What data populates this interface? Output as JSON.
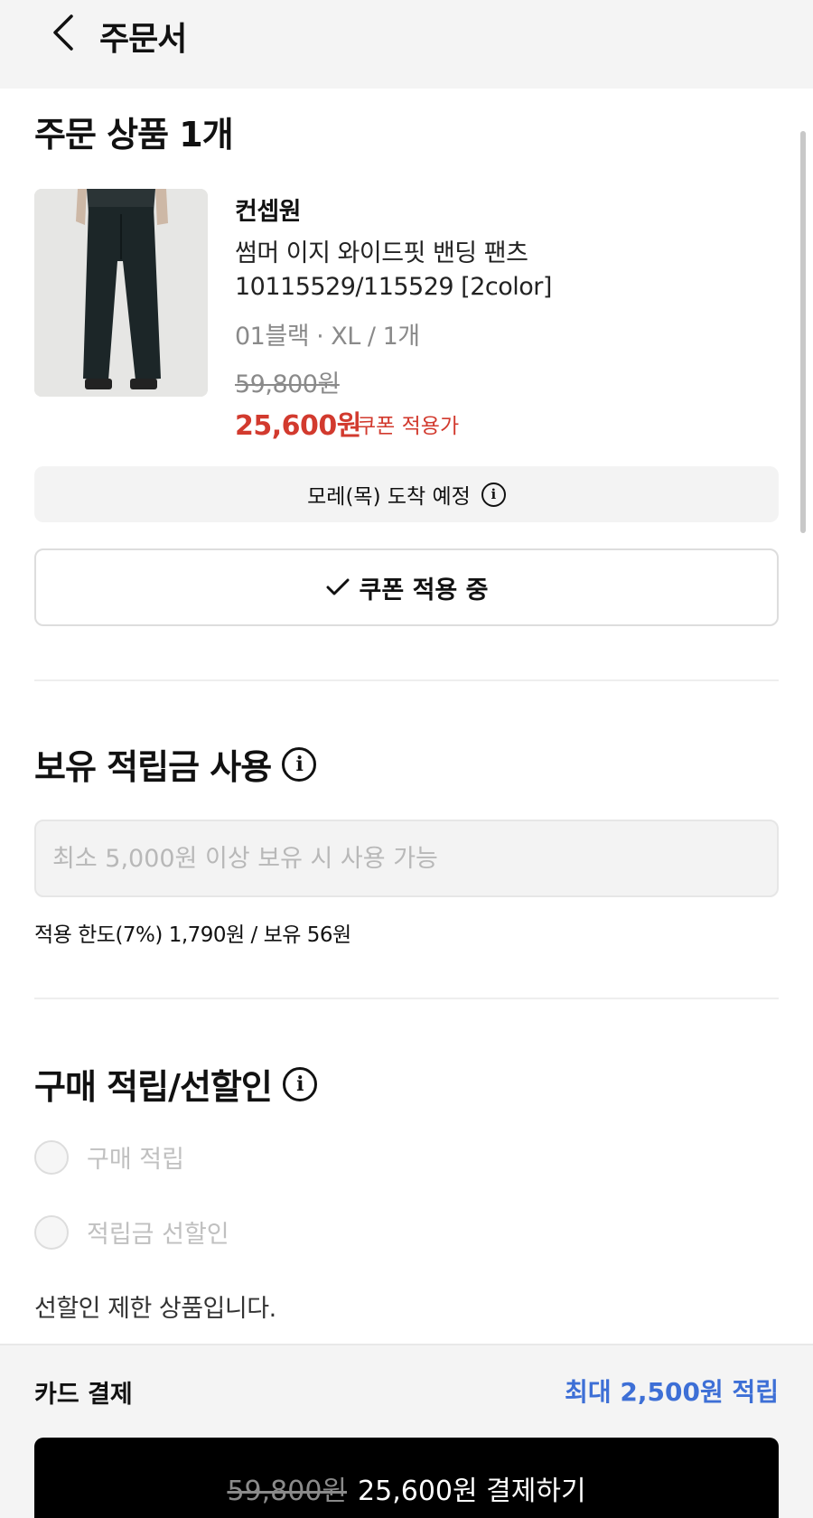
{
  "header": {
    "title": "주문서"
  },
  "order": {
    "title": "주문 상품 1개",
    "product": {
      "brand": "컨셉원",
      "name": "썸머 이지 와이드핏 밴딩 팬츠",
      "code": "10115529/115529 [2color]",
      "option": "01블랙 · XL / 1개",
      "original_price": "59,800원",
      "coupon_price": "25,600원",
      "coupon_price_label": "쿠폰 적용가"
    },
    "delivery": "모레(목) 도착 예정",
    "coupon_button": "쿠폰 적용 중"
  },
  "points": {
    "title": "보유 적립금 사용",
    "placeholder": "최소 5,000원 이상 보유 시 사용 가능",
    "limit_text": "적용 한도(7%) 1,790원 / 보유 56원"
  },
  "reward": {
    "title": "구매 적립/선할인",
    "options": [
      "구매 적립",
      "적립금 선할인"
    ],
    "notice": "선할인 제한 상품입니다."
  },
  "footer": {
    "payment_method": "카드 결제",
    "max_reward": "최대 2,500원 적립",
    "pay_original": "59,800원",
    "pay_label": "25,600원 결제하기"
  },
  "colors": {
    "sale": "#d23a2e",
    "accent": "#3d6fd6",
    "button": "#000000"
  }
}
